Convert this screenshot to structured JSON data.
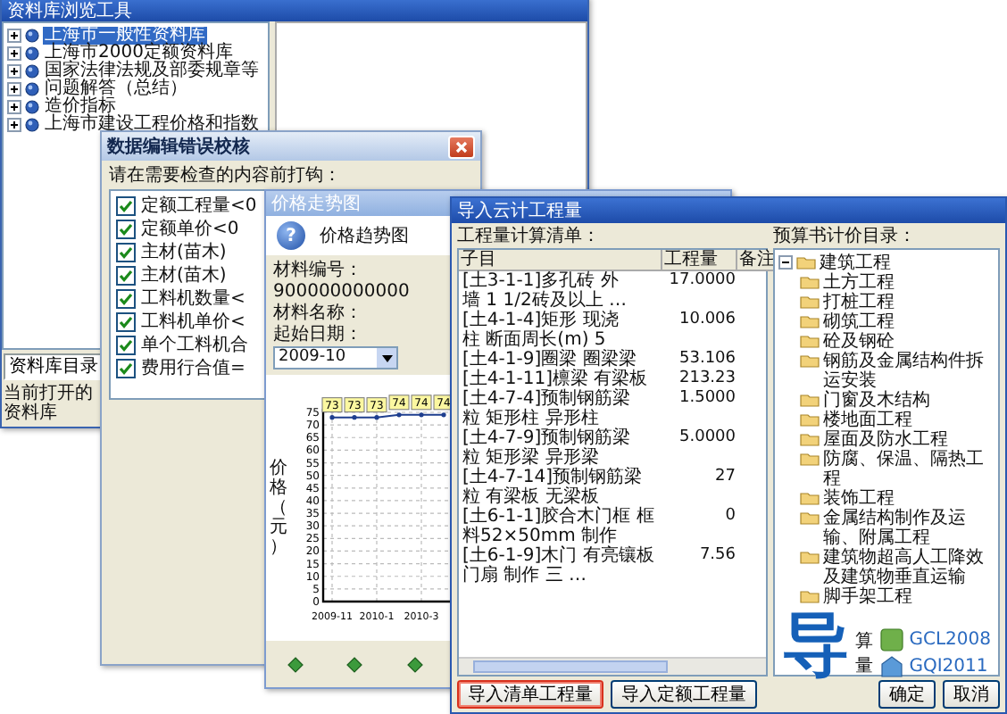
{
  "library_window": {
    "title": "资料库浏览工具",
    "tree": [
      {
        "label": "上海市一般性资料库",
        "selected": true,
        "expanded": false
      },
      {
        "label": "上海市2000定额资料库",
        "selected": false,
        "expanded": false
      },
      {
        "label": "国家法律法规及部委规章等",
        "selected": false,
        "expanded": false
      },
      {
        "label": "问题解答（总结）",
        "selected": false,
        "expanded": false
      },
      {
        "label": "造价指标",
        "selected": false,
        "expanded": false
      },
      {
        "label": "上海市建设工程价格和指数",
        "selected": false,
        "expanded": false
      }
    ],
    "tabs": [
      {
        "label": "资料库目录",
        "selected": true
      }
    ],
    "status": "当前打开的资料库"
  },
  "check_dialog": {
    "title": "数据编辑错误校核",
    "prompt": "请在需要检查的内容前打钩：",
    "items": [
      {
        "label": "定额工程量<0",
        "checked": true
      },
      {
        "label": "定额单价<0",
        "checked": true
      },
      {
        "label": "主材(苗木)",
        "checked": true
      },
      {
        "label": "主材(苗木)",
        "checked": true
      },
      {
        "label": "工料机数量<",
        "checked": true
      },
      {
        "label": "工料机单价<",
        "checked": true
      },
      {
        "label": "单个工料机合",
        "checked": true
      },
      {
        "label": "费用行合值=",
        "checked": true
      }
    ]
  },
  "price_window": {
    "title": "价格走势图",
    "heading_icon": "?",
    "heading": "价格趋势图",
    "material_code": {
      "label": "材料编号：",
      "value": "900000000000"
    },
    "material_name": {
      "label": "材料名称："
    },
    "start_date": {
      "label": "起始日期：",
      "value": "2009-10"
    },
    "chart_data": {
      "type": "line",
      "ylabel": "价格（元）",
      "categories": [
        "2009-11",
        null,
        "2010-1",
        null,
        "2010-3",
        null
      ],
      "values": [
        73,
        73,
        73,
        74,
        74,
        74
      ],
      "ylim": [
        0,
        75
      ],
      "grid": true,
      "yticks": [
        0,
        5,
        10,
        15,
        20,
        25,
        30,
        35,
        40,
        45,
        50,
        55,
        60,
        65,
        70,
        75
      ],
      "data_labels": true
    }
  },
  "import_window": {
    "title": "导入云计工程量",
    "list_label": "工程量计算清单：",
    "columns": [
      "子目",
      "工程量",
      "备注"
    ],
    "rows": [
      {
        "item": "[土3-1-1]多孔砖 外墙 1 1/2砖及以上 …",
        "quantity": "17.0000"
      },
      {
        "item": "[土4-1-4]矩形 现浇柱 断面周长(m) 5",
        "quantity": "10.006"
      },
      {
        "item": "[土4-1-9]圈梁 圈梁梁",
        "quantity": "53.106"
      },
      {
        "item": "[土4-1-11]檩梁 有梁板",
        "quantity": "213.23"
      },
      {
        "item": "[土4-7-4]预制钢筋梁粒 矩形柱 异形柱",
        "quantity": "1.5000"
      },
      {
        "item": "[土4-7-9]预制钢筋梁粒 矩形梁 异形梁",
        "quantity": "5.0000"
      },
      {
        "item": "[土4-7-14]预制钢筋梁粒 有梁板 无梁板",
        "quantity": "27"
      },
      {
        "item": "[土6-1-1]胶合木门框 框料52×50mm 制作",
        "quantity": "0"
      },
      {
        "item": "[土6-1-9]木门 有亮镶板门扇 制作 三 …",
        "quantity": "7.56"
      }
    ],
    "tree_label": "预算书计价目录：",
    "tree": [
      {
        "label": "建筑工程",
        "expanded": true,
        "children": [
          {
            "label": "土方工程"
          },
          {
            "label": "打桩工程"
          },
          {
            "label": "砌筑工程"
          },
          {
            "label": "砼及钢砼"
          },
          {
            "label": "钢筋及金属结构件拆运安装"
          },
          {
            "label": "门窗及木结构"
          },
          {
            "label": "楼地面工程"
          },
          {
            "label": "屋面及防水工程"
          },
          {
            "label": "防腐、保温、隔热工程"
          },
          {
            "label": "装饰工程"
          },
          {
            "label": "金属结构制作及运输、附属工程"
          },
          {
            "label": "建筑物超高人工降效及建筑物垂直运输"
          },
          {
            "label": "脚手架工程"
          }
        ]
      }
    ],
    "logo": {
      "mark": "导",
      "caption": "算量",
      "products": [
        "GCL2008",
        "GQI2011"
      ]
    },
    "buttons": [
      {
        "label": "导入清单工程量",
        "highlighted": true
      },
      {
        "label": "导入定额工程量",
        "highlighted": false
      },
      {
        "label": "确定",
        "highlighted": false
      },
      {
        "label": "取消",
        "highlighted": false
      }
    ]
  }
}
